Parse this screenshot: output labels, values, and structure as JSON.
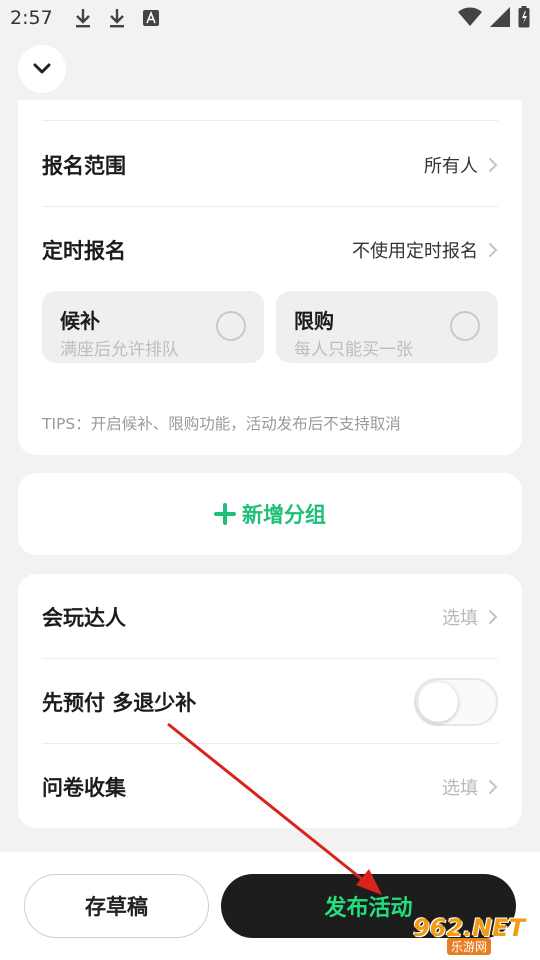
{
  "status_bar": {
    "time": "2:57",
    "left_icons": [
      "download-icon",
      "download-icon",
      "font-icon"
    ],
    "right_icons": [
      "wifi-icon",
      "signal-icon",
      "battery-icon"
    ]
  },
  "settings_card": {
    "rows": [
      {
        "label": "报名范围",
        "value": "所有人"
      },
      {
        "label": "定时报名",
        "value": "不使用定时报名"
      }
    ],
    "options": [
      {
        "title": "候补",
        "subtitle": "满座后允许排队",
        "checked": false
      },
      {
        "title": "限购",
        "subtitle": "每人只能买一张",
        "checked": false
      }
    ],
    "tips": "TIPS：开启候补、限购功能，活动发布后不支持取消"
  },
  "add_group": {
    "label": "新增分组"
  },
  "extra_card": {
    "rows": [
      {
        "label": "会玩达人",
        "value": "选填"
      },
      {
        "label": "先预付 多退少补",
        "toggle_on": false
      },
      {
        "label": "问卷收集",
        "value": "选填"
      }
    ]
  },
  "bottom_bar": {
    "draft_label": "存草稿",
    "publish_label": "发布活动"
  },
  "watermark": {
    "main": "962.NET",
    "sub": "乐游网"
  },
  "colors": {
    "accent_green": "#1fbf7a",
    "publish_text": "#22e07c",
    "annotation_red": "#d9231c"
  }
}
